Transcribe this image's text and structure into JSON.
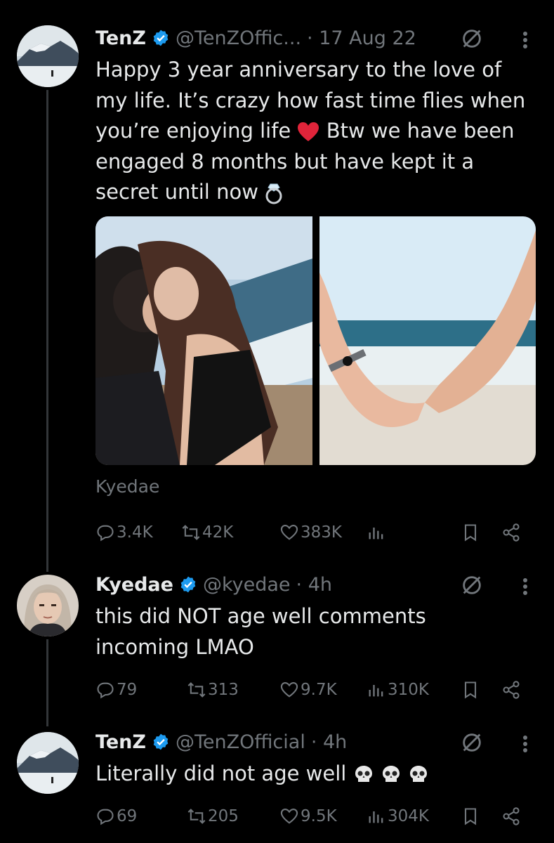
{
  "tweets": [
    {
      "name": "TenZ",
      "handle": "@TenZOffic...",
      "time": "· 17 Aug 22",
      "text_lines": [
        "Happy 3 year anniversary to the love of",
        "my life. It’s crazy how fast time flies when",
        "you’re enjoying life",
        "engaged 8 months but have kept it a",
        "secret until now"
      ],
      "text_line3_after": "Btw we have been",
      "tag": "Kyedae",
      "replies": "3.4K",
      "retweets": "42K",
      "likes": "383K",
      "views": ""
    },
    {
      "name": "Kyedae",
      "handle": "@kyedae",
      "time": "· 4h",
      "text_lines": [
        "this did NOT age well comments",
        "incoming LMAO"
      ],
      "replies": "79",
      "retweets": "313",
      "likes": "9.7K",
      "views": "310K"
    },
    {
      "name": "TenZ",
      "handle": "@TenZOfficial",
      "time": "· 4h",
      "text_lines": [
        "Literally did not age well"
      ],
      "replies": "69",
      "retweets": "205",
      "likes": "9.5K",
      "views": "304K"
    }
  ],
  "colors": {
    "background": "#000000",
    "text": "#e7e9ea",
    "muted": "#71767b",
    "verified": "#1d9bf0",
    "heart": "#f91880"
  },
  "icons": [
    "verified-badge-icon",
    "grok-icon",
    "more-icon",
    "reply-icon",
    "retweet-icon",
    "like-icon",
    "views-icon",
    "bookmark-icon",
    "share-icon",
    "heart-emoji-icon",
    "ring-emoji-icon",
    "skull-emoji-icon"
  ]
}
